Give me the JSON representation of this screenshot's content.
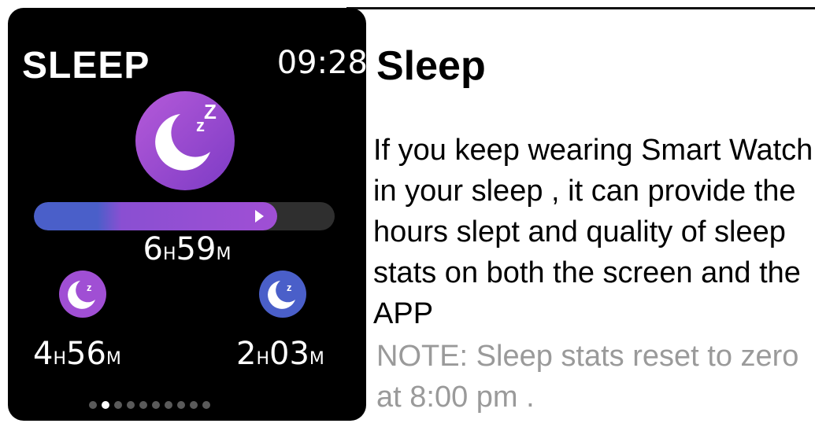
{
  "watch": {
    "title": "SLEEP",
    "time": "09:28",
    "progress_fraction": 0.81,
    "deep_fraction": 0.21,
    "total": {
      "hours": "6",
      "h_unit": "H",
      "minutes": "59",
      "m_unit": "M"
    },
    "light": {
      "hours": "4",
      "h_unit": "H",
      "minutes": "56",
      "m_unit": "M"
    },
    "deep": {
      "hours": "2",
      "h_unit": "H",
      "minutes": "03",
      "m_unit": "M"
    },
    "page_count": 10,
    "active_page": 1,
    "colors": {
      "light_purple": "#a04fd4",
      "deep_blue": "#4a5fc9",
      "track": "#2f2f2f"
    },
    "icons": {
      "main": "moon-zz-icon",
      "light": "moon-z-icon",
      "deep": "moon-z-icon"
    }
  },
  "panel": {
    "heading": "Sleep",
    "description": "If you keep wearing Smart Watch in your sleep , it can provide the hours slept and quality of sleep stats on both the screen and the APP",
    "note": "NOTE: Sleep stats reset to zero at 8:00 pm ."
  }
}
